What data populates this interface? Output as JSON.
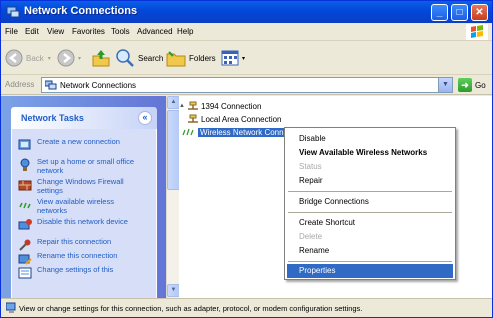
{
  "window": {
    "title": "Network Connections",
    "buttons": {
      "minimize": "_",
      "maximize": "□",
      "close": "✕"
    }
  },
  "menubar": {
    "items": [
      "File",
      "Edit",
      "View",
      "Favorites",
      "Tools",
      "Advanced",
      "Help"
    ]
  },
  "toolbar": {
    "back_label": "Back",
    "search_label": "Search",
    "folders_label": "Folders"
  },
  "addressbar": {
    "label": "Address",
    "value": "Network Connections",
    "go_label": "Go"
  },
  "tasks": {
    "header": "Network Tasks",
    "collapse_glyph": "«",
    "items": [
      {
        "label": "Create a new connection",
        "icon": "new-connection-icon"
      },
      {
        "label": "Set up a home or small office network",
        "icon": "home-network-icon"
      },
      {
        "label": "Change Windows Firewall settings",
        "icon": "firewall-icon"
      },
      {
        "label": "View available wireless networks",
        "icon": "wireless-icon"
      },
      {
        "label": "Disable this network device",
        "icon": "disable-device-icon"
      },
      {
        "label": "Repair this connection",
        "icon": "repair-icon"
      },
      {
        "label": "Rename this connection",
        "icon": "rename-icon"
      },
      {
        "label": "Change settings of this",
        "icon": "settings-icon"
      }
    ]
  },
  "connections": [
    {
      "label": "1394 Connection",
      "icon": "network-adapter-icon"
    },
    {
      "label": "Local Area Connection",
      "icon": "network-adapter-icon"
    },
    {
      "label": "Wireless Network Conn",
      "icon": "wireless-adapter-icon",
      "selected": true
    }
  ],
  "context_menu": {
    "items": [
      {
        "label": "Disable"
      },
      {
        "label": "View Available Wireless Networks",
        "bold": true
      },
      {
        "label": "Status",
        "disabled": true
      },
      {
        "label": "Repair"
      },
      {
        "label": "Bridge Connections"
      },
      {
        "label": "Create Shortcut"
      },
      {
        "label": "Delete",
        "disabled": true
      },
      {
        "label": "Rename"
      },
      {
        "label": "Properties",
        "highlighted": true
      }
    ]
  },
  "statusbar": {
    "text": "View or change settings for this connection, such as adapter, protocol, or modem configuration settings."
  },
  "colors": {
    "titlebar": "#0347d9",
    "selection": "#316ac5",
    "task_link": "#215dc6"
  }
}
